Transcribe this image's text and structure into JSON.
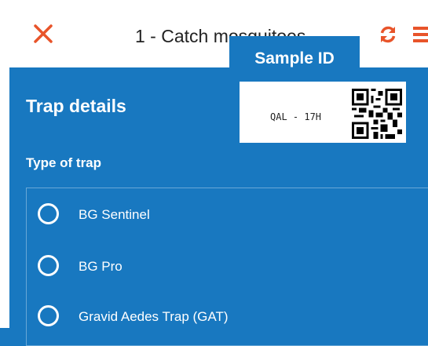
{
  "header": {
    "title": "1 - Catch mosquitoes",
    "close_icon": "close-icon",
    "sync_icon": "sync-icon",
    "menu_icon": "menu-icon",
    "accent_color": "#e8542a"
  },
  "sample": {
    "label": "Sample ID",
    "id_value": "QAL - 17H",
    "qr_icon": "qr-code-icon"
  },
  "form": {
    "section_title": "Trap details",
    "field_label": "Type of trap",
    "options": [
      {
        "label": "BG Sentinel",
        "selected": false
      },
      {
        "label": "BG Pro",
        "selected": false
      },
      {
        "label": "Gravid Aedes Trap (GAT)",
        "selected": false
      }
    ]
  },
  "colors": {
    "background": "#1878c0",
    "header_bg": "#ffffff"
  }
}
